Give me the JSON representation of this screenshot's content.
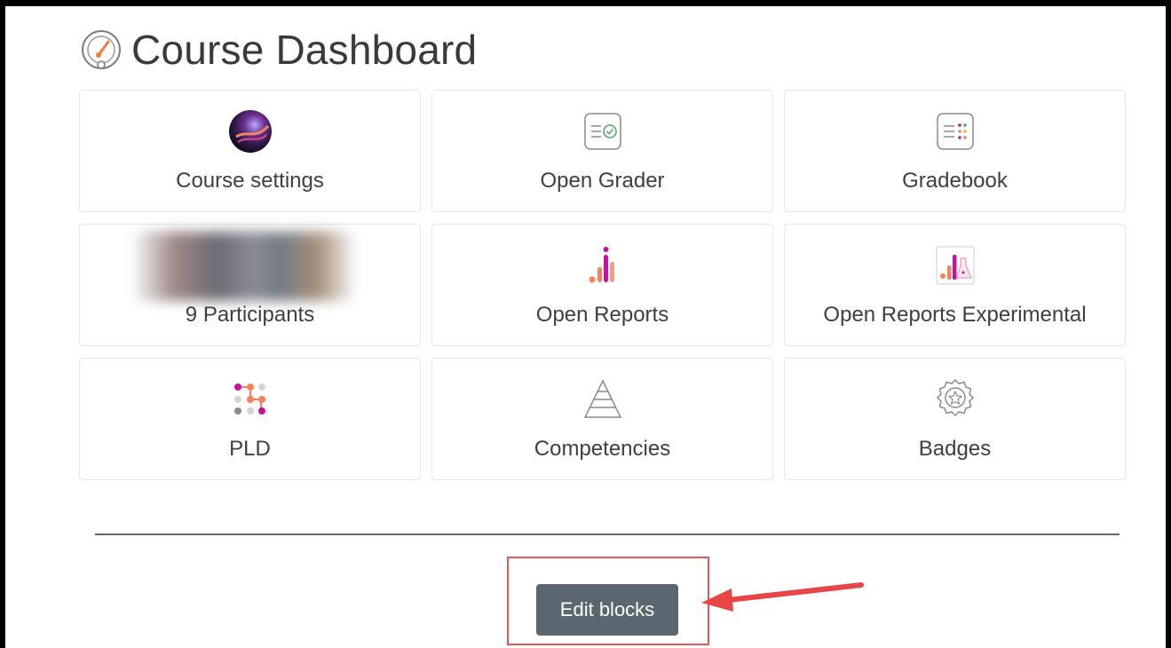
{
  "page": {
    "title": "Course Dashboard"
  },
  "tiles": [
    {
      "label": "Course settings",
      "icon": "course-settings-icon"
    },
    {
      "label": "Open Grader",
      "icon": "open-grader-icon"
    },
    {
      "label": "Gradebook",
      "icon": "gradebook-icon"
    },
    {
      "label": "9 Participants",
      "icon": "participant-avatars"
    },
    {
      "label": "Open Reports",
      "icon": "reports-bar-chart-icon"
    },
    {
      "label": "Open Reports Experimental",
      "icon": "reports-experimental-icon"
    },
    {
      "label": "PLD",
      "icon": "pld-dots-icon"
    },
    {
      "label": "Competencies",
      "icon": "pyramid-icon"
    },
    {
      "label": "Badges",
      "icon": "badge-icon"
    }
  ],
  "footer": {
    "edit_blocks_label": "Edit blocks"
  },
  "colors": {
    "accent_orange": "#f7825a",
    "accent_magenta": "#c8109e",
    "button": "#5b6770",
    "highlight": "#e45a5a"
  }
}
